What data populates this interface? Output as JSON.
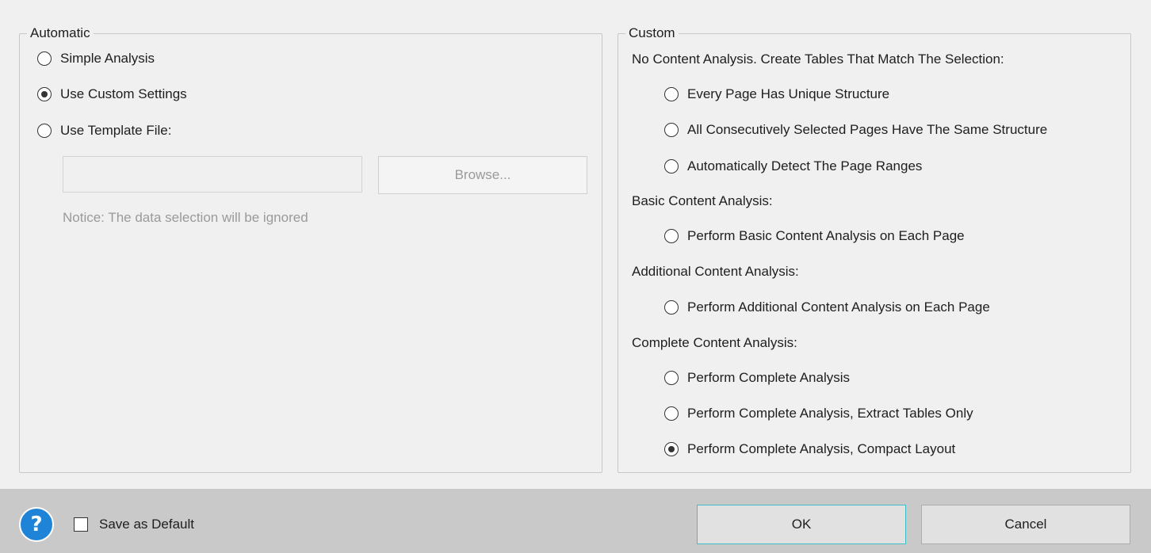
{
  "automatic": {
    "legend": "Automatic",
    "options": [
      {
        "label": "Simple Analysis",
        "checked": false
      },
      {
        "label": "Use Custom Settings",
        "checked": true
      },
      {
        "label": "Use Template File:",
        "checked": false
      }
    ],
    "template_path_value": "",
    "browse_label": "Browse...",
    "notice": "Notice: The data selection will be ignored"
  },
  "custom": {
    "legend": "Custom",
    "sections": [
      {
        "heading": "No Content Analysis. Create Tables That Match The Selection:",
        "options": [
          {
            "label": "Every Page Has Unique Structure",
            "checked": false
          },
          {
            "label": "All Consecutively Selected Pages Have The Same Structure",
            "checked": false
          },
          {
            "label": "Automatically Detect The Page Ranges",
            "checked": false
          }
        ]
      },
      {
        "heading": "Basic Content Analysis:",
        "options": [
          {
            "label": "Perform Basic Content Analysis on Each Page",
            "checked": false
          }
        ]
      },
      {
        "heading": "Additional Content Analysis:",
        "options": [
          {
            "label": "Perform Additional Content Analysis on Each Page",
            "checked": false
          }
        ]
      },
      {
        "heading": "Complete Content Analysis:",
        "options": [
          {
            "label": "Perform Complete Analysis",
            "checked": false
          },
          {
            "label": "Perform Complete Analysis, Extract Tables Only",
            "checked": false
          },
          {
            "label": "Perform Complete Analysis, Compact Layout",
            "checked": true
          }
        ]
      }
    ]
  },
  "footer": {
    "help_glyph": "?",
    "save_default_label": "Save as Default",
    "save_default_checked": false,
    "ok_label": "OK",
    "cancel_label": "Cancel"
  },
  "colors": {
    "background": "#f0f0f0",
    "footer": "#c9c9c9",
    "help_icon": "#1f84d8",
    "ok_focus_border": "#3dbfc9",
    "disabled_text": "#9a9a9a"
  }
}
